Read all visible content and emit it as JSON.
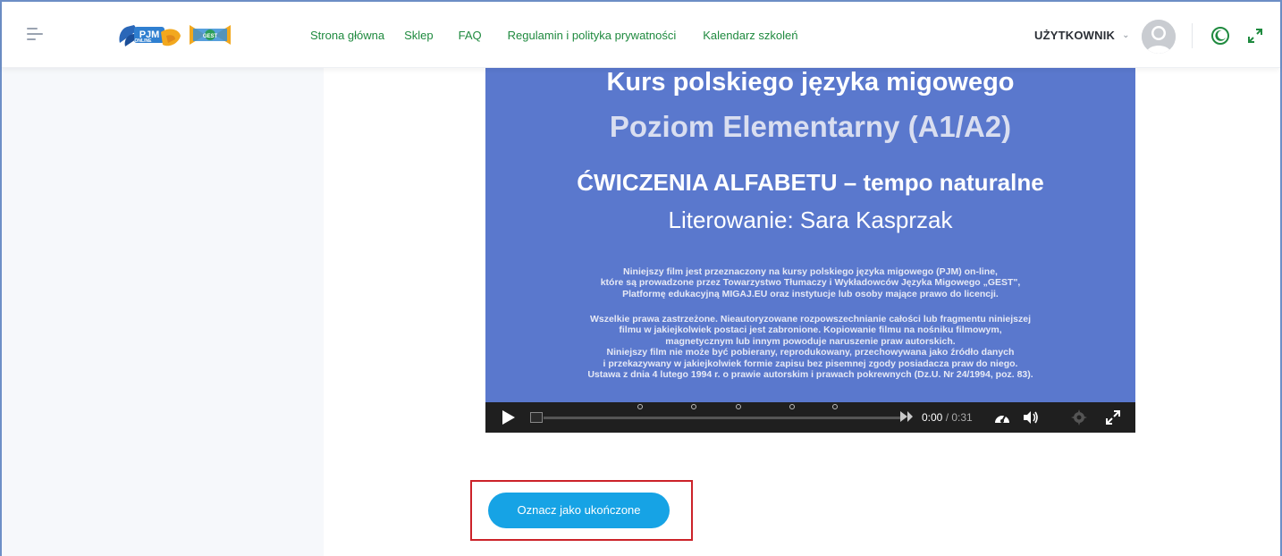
{
  "header": {
    "nav": [
      {
        "label": "Strona główna"
      },
      {
        "label": "Sklep"
      },
      {
        "label": "FAQ"
      },
      {
        "label": "Regulamin i polityka prywatności"
      },
      {
        "label": "Kalendarz szkoleń"
      }
    ],
    "user_label": "UŻYTKOWNIK",
    "logo_pjm_text": "PJM",
    "logo_pjm_sub": "ONLINE",
    "logo_gest_text": "GEST",
    "accent_color": "#1f8a3f"
  },
  "video": {
    "title_line1": "Kurs polskiego języka migowego",
    "title_line2": "Poziom Elementarny (A1/A2)",
    "title_line3": "ĆWICZENIA ALFABETU – tempo naturalne",
    "title_line4": "Literowanie: Sara Kasprzak",
    "para1": [
      "Niniejszy film jest przeznaczony na kursy polskiego języka migowego (PJM) on-line,",
      "które są prowadzone przez Towarzystwo Tłumaczy i Wykładowców Języka Migowego „GEST\",",
      "Platformę edukacyjną MIGAJ.EU oraz instytucje lub osoby mające prawo do licencji."
    ],
    "para2": [
      "Wszelkie prawa zastrzeżone. Nieautoryzowane rozpowszechnianie całości lub fragmentu niniejszej",
      "filmu w jakiejkolwiek postaci jest zabronione. Kopiowanie filmu na nośniku filmowym,",
      "magnetycznym lub innym powoduje naruszenie praw autorskich.",
      "Niniejszy film nie może być pobierany, reprodukowany, przechowywana jako źródło danych",
      "i przekazywany w jakiejkolwiek formie zapisu bez pisemnej zgody posiadacza praw do niego.",
      "Ustawa z dnia 4 lutego 1994 r. o prawie autorskim i prawach pokrewnych (Dz.U. Nr 24/1994, poz. 83)."
    ],
    "time_current": "0:00",
    "time_separator": " / ",
    "time_total": "0:31",
    "progress": 0.0,
    "background_color": "#5a78cd"
  },
  "mark_complete": {
    "label": "Oznacz jako ukończone",
    "button_color": "#16a3e5",
    "highlight_color": "#cc2229"
  }
}
